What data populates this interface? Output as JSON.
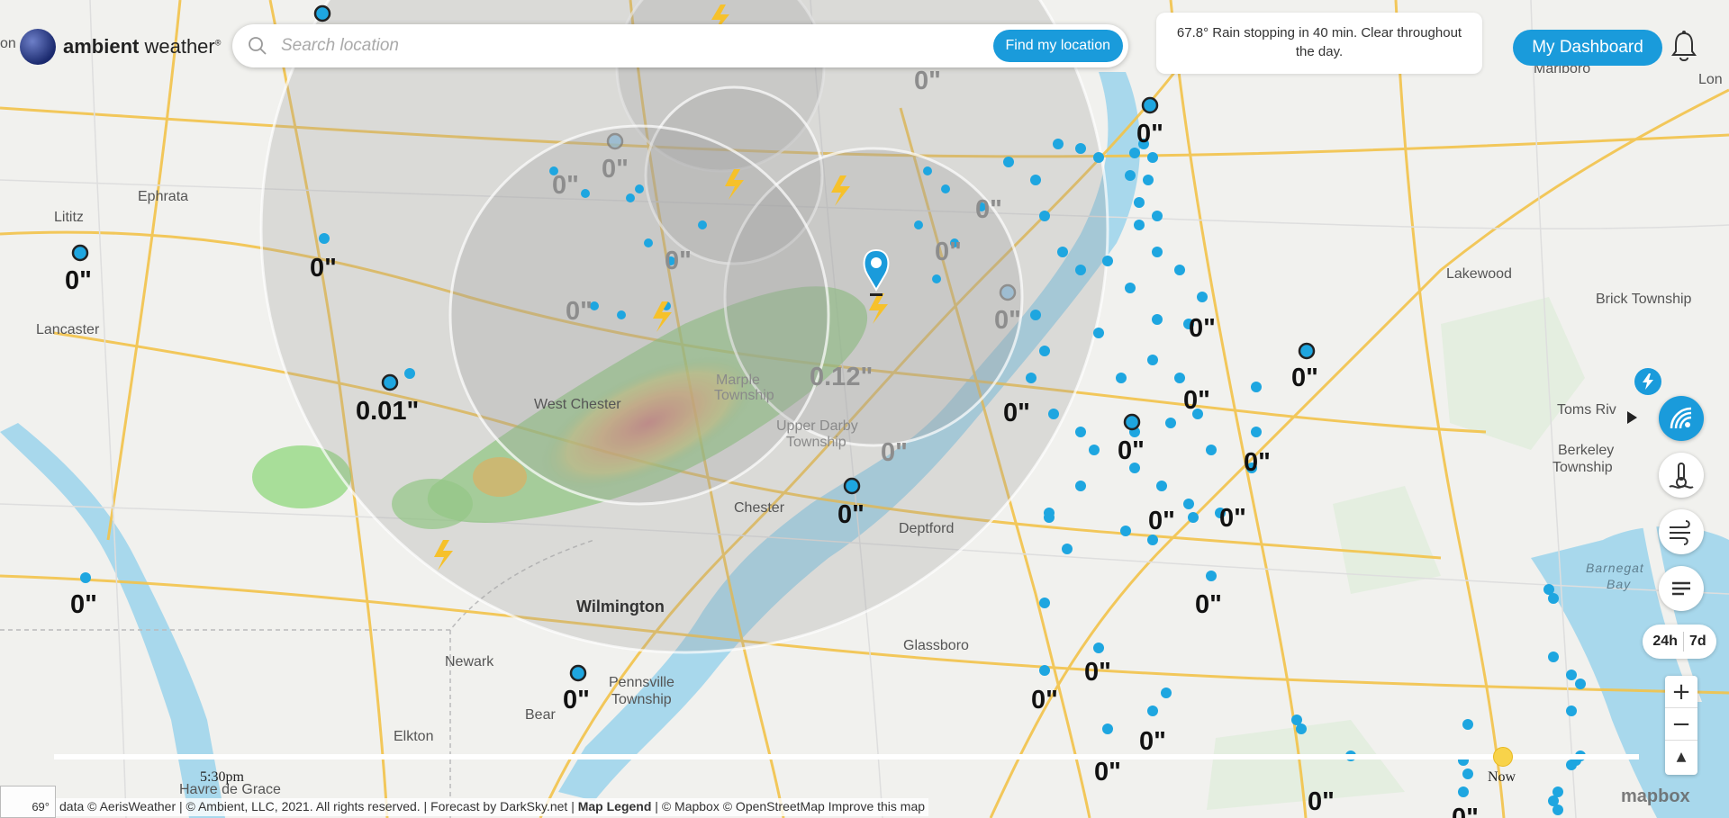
{
  "app": {
    "brand_bold": "ambient",
    "brand_light": " weather",
    "brand_reg": "®"
  },
  "search": {
    "placeholder": "Search location",
    "find_label": "Find my location"
  },
  "forecast": {
    "text": "67.8° Rain stopping in 40 min. Clear throughout the day."
  },
  "header": {
    "dashboard_label": "My Dashboard"
  },
  "controls": {
    "range_24h": "24h",
    "range_7d": "7d",
    "zoom_in": "+",
    "zoom_out": "−",
    "compass": "▲"
  },
  "timeline": {
    "start_time": "5:30pm",
    "now_label": "Now"
  },
  "attribution": {
    "prefix": "data © AerisWeather | © Ambient, LLC, 2021. All rights reserved. | Forecast by DarkSky.net | ",
    "legend": "Map Legend",
    "suffix": " | © Mapbox © OpenStreetMap Improve this map"
  },
  "temp_badge": "69°",
  "mapbox": "mapbox",
  "places": [
    {
      "name": "Ephrata"
    },
    {
      "name": "Lititz"
    },
    {
      "name": "Lancaster"
    },
    {
      "name": "West Chester"
    },
    {
      "name": "Marple"
    },
    {
      "name": "Township"
    },
    {
      "name": "Upper Darby"
    },
    {
      "name": "Township"
    },
    {
      "name": "Chester"
    },
    {
      "name": "Deptford"
    },
    {
      "name": "Wilmington"
    },
    {
      "name": "Newark"
    },
    {
      "name": "Pennsville"
    },
    {
      "name": "Township"
    },
    {
      "name": "Glassboro"
    },
    {
      "name": "Bear"
    },
    {
      "name": "Elkton"
    },
    {
      "name": "Havre de Grace"
    },
    {
      "name": "Lakewood"
    },
    {
      "name": "Brick Township"
    },
    {
      "name": "Toms Riv"
    },
    {
      "name": "Berkeley"
    },
    {
      "name": "Township"
    },
    {
      "name": "Barnegat"
    },
    {
      "name": "Bay"
    },
    {
      "name": "Marlboro"
    },
    {
      "name": "Lon"
    },
    {
      "name": "on"
    }
  ],
  "rainfall": [
    {
      "value": "0\""
    },
    {
      "value": "0\""
    },
    {
      "value": "0\""
    },
    {
      "value": "0\""
    },
    {
      "value": "0\""
    },
    {
      "value": "0\""
    },
    {
      "value": "0\""
    },
    {
      "value": "0\""
    },
    {
      "value": "0\""
    },
    {
      "value": "0\""
    },
    {
      "value": "0.01\""
    },
    {
      "value": "0.12\""
    },
    {
      "value": "0\""
    },
    {
      "value": "0\""
    },
    {
      "value": "0\""
    },
    {
      "value": "0\""
    },
    {
      "value": "0\""
    },
    {
      "value": "0\""
    },
    {
      "value": "0\""
    },
    {
      "value": "0\""
    },
    {
      "value": "0\""
    },
    {
      "value": "0\""
    },
    {
      "value": "0\""
    },
    {
      "value": "0\""
    },
    {
      "value": "0\""
    },
    {
      "value": "0\""
    },
    {
      "value": "0\""
    },
    {
      "value": "0\""
    },
    {
      "value": "0\""
    },
    {
      "value": "0\""
    },
    {
      "value": "0\""
    },
    {
      "value": "0\""
    }
  ],
  "colors": {
    "accent": "#1a9bdb",
    "station": "#1ea6e0",
    "lightning": "#f6c12b",
    "road": "#f3c34a",
    "water": "#a8d8ec"
  }
}
